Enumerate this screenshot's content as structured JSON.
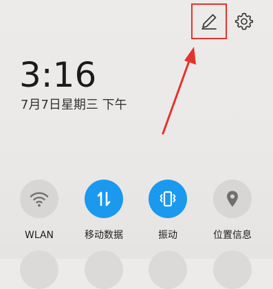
{
  "header": {
    "edit_icon": "pencil-icon",
    "settings_icon": "gear-icon",
    "highlight_color": "#e5322d"
  },
  "clock": {
    "time": "3:16",
    "date": "7月7日星期三 下午"
  },
  "tiles": [
    {
      "label": "WLAN",
      "icon": "wifi-icon",
      "active": false
    },
    {
      "label": "移动数据",
      "icon": "mobile-data-icon",
      "active": true
    },
    {
      "label": "振动",
      "icon": "vibrate-icon",
      "active": true
    },
    {
      "label": "位置信息",
      "icon": "location-icon",
      "active": false
    }
  ],
  "colors": {
    "active": "#1a99ee",
    "inactive": "#d8d6d4",
    "annotation": "#e5322d"
  }
}
